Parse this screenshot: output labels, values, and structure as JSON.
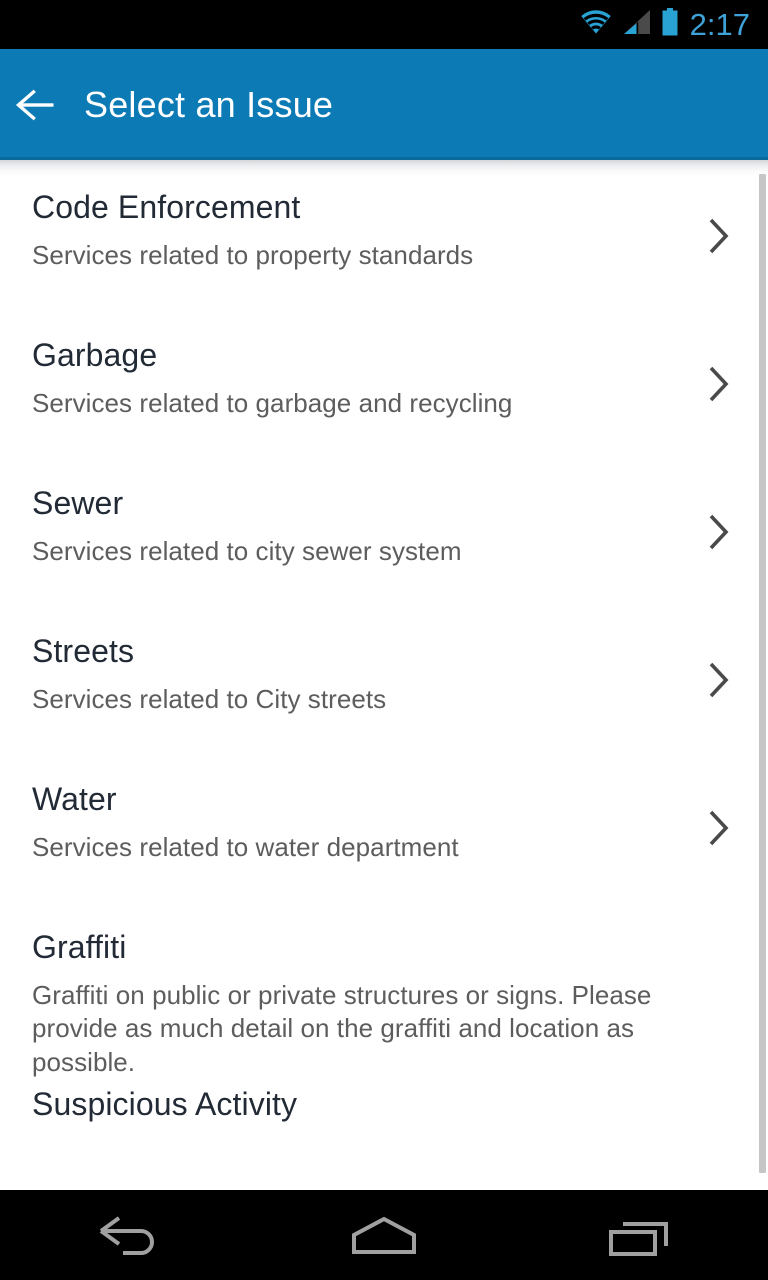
{
  "status_bar": {
    "time": "2:17",
    "icons": [
      "wifi-icon",
      "cellular-signal-icon",
      "battery-icon"
    ],
    "time_color": "#3ea2d8",
    "background": "#000000"
  },
  "app_bar": {
    "title": "Select an Issue",
    "back_icon": "arrow-left-icon",
    "background": "#0b7ab5",
    "text_color": "#ffffff"
  },
  "list": {
    "items": [
      {
        "title": "Code Enforcement",
        "description": "Services related to property standards",
        "chevron": true
      },
      {
        "title": "Garbage",
        "description": "Services related to garbage and recycling",
        "chevron": true
      },
      {
        "title": "Sewer",
        "description": "Services related to city sewer system",
        "chevron": true
      },
      {
        "title": "Streets",
        "description": "Services related to City streets",
        "chevron": true
      },
      {
        "title": "Water",
        "description": "Services related to water department",
        "chevron": true
      },
      {
        "title": "Graffiti",
        "description": "Graffiti on public or private structures or signs. Please provide as much detail on the graffiti and location as possible.",
        "chevron": false
      },
      {
        "title": "Suspicious Activity",
        "description": "",
        "chevron": false
      }
    ],
    "title_color": "#222a35",
    "description_color": "#5d5d5d",
    "background": "#ffffff",
    "chevron_icon": "chevron-right-icon",
    "scrollbar_color": "#c6c6c6"
  },
  "nav_bar": {
    "background": "#000000",
    "icon_color": "#a0a0a0",
    "buttons": [
      {
        "name": "back-nav-icon"
      },
      {
        "name": "home-nav-icon"
      },
      {
        "name": "recents-nav-icon"
      }
    ]
  }
}
